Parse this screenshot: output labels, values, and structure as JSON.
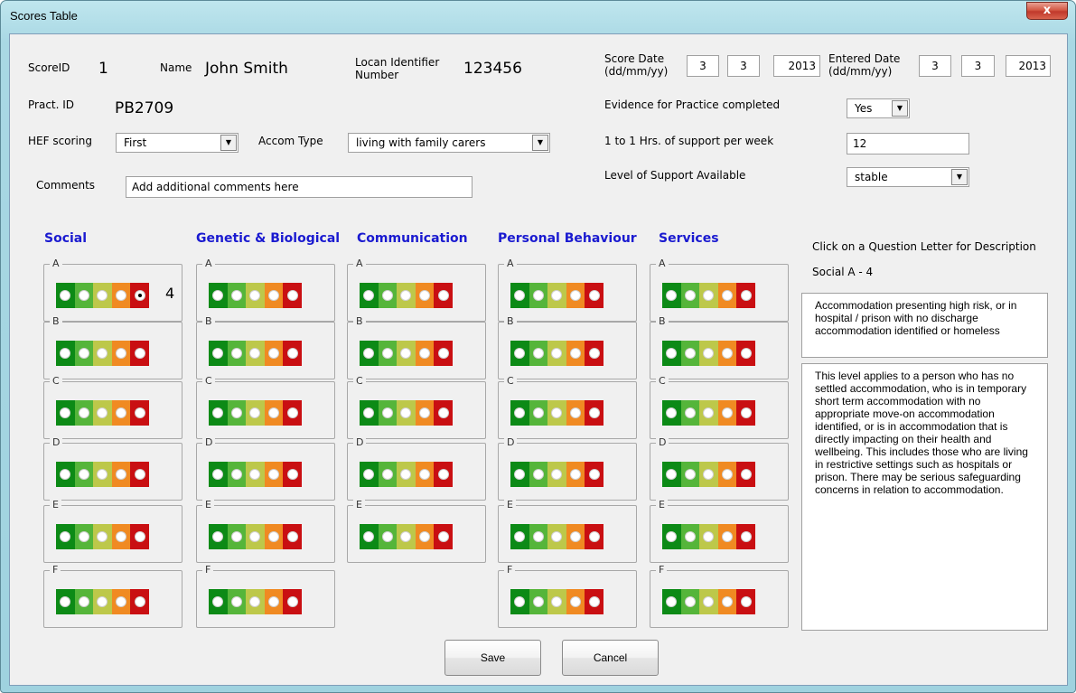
{
  "window": {
    "title": "Scores Table",
    "close_glyph": "x"
  },
  "fields": {
    "score_id_label": "ScoreID",
    "score_id_value": "1",
    "name_label": "Name",
    "name_value": "John Smith",
    "locan_label_1": "Locan Identifier",
    "locan_label_2": "Number",
    "locan_value": "123456",
    "pract_id_label": "Pract. ID",
    "pract_id_value": "PB2709",
    "hef_label": "HEF scoring",
    "hef_value": "First",
    "accom_label": "Accom Type",
    "accom_value": "living with family carers",
    "comments_label": "Comments",
    "comments_placeholder": "Add additional comments here",
    "score_date_label_1": "Score Date",
    "score_date_label_2": "(dd/mm/yy)",
    "score_date": {
      "day": "3",
      "month": "3",
      "year": "2013"
    },
    "entered_date_label_1": "Entered Date",
    "entered_date_label_2": "(dd/mm/yy)",
    "entered_date": {
      "day": "3",
      "month": "3",
      "year": "2013"
    },
    "evidence_label": "Evidence for Practice completed",
    "evidence_value": "Yes",
    "support_hours_label": "1 to 1 Hrs. of support per week",
    "support_hours_value": "12",
    "support_level_label": "Level of Support Available",
    "support_level_value": "stable"
  },
  "categories": [
    {
      "name": "Social",
      "questions": [
        "A",
        "B",
        "C",
        "D",
        "E",
        "F"
      ],
      "selected": {
        "A": 4
      }
    },
    {
      "name": "Genetic & Biological",
      "questions": [
        "A",
        "B",
        "C",
        "D",
        "E",
        "F"
      ]
    },
    {
      "name": "Communication",
      "questions": [
        "A",
        "B",
        "C",
        "D",
        "E"
      ]
    },
    {
      "name": "Personal Behaviour",
      "questions": [
        "A",
        "B",
        "C",
        "D",
        "E",
        "F"
      ]
    },
    {
      "name": "Services",
      "questions": [
        "A",
        "B",
        "C",
        "D",
        "E",
        "F"
      ]
    }
  ],
  "score_display": {
    "social_a": "4"
  },
  "light_colors": [
    "#0c8a16",
    "#55b53a",
    "#bdc84a",
    "#f08a22",
    "#c90f12"
  ],
  "description": {
    "instruction": "Click on a Question Letter for Description",
    "selected_label": "Social A - 4",
    "summary": "Accommodation presenting high risk, or in hospital / prison with no discharge accommodation identified or homeless",
    "detail": "This level applies to a person who has no settled accommodation, who is in temporary short term accommodation with no appropriate move-on accommodation identified, or is in accommodation that is directly impacting on their health and wellbeing. This includes those who are living in restrictive settings such as hospitals or prison. There may be serious safeguarding concerns in relation to accommodation."
  },
  "buttons": {
    "save": "Save",
    "cancel": "Cancel"
  }
}
